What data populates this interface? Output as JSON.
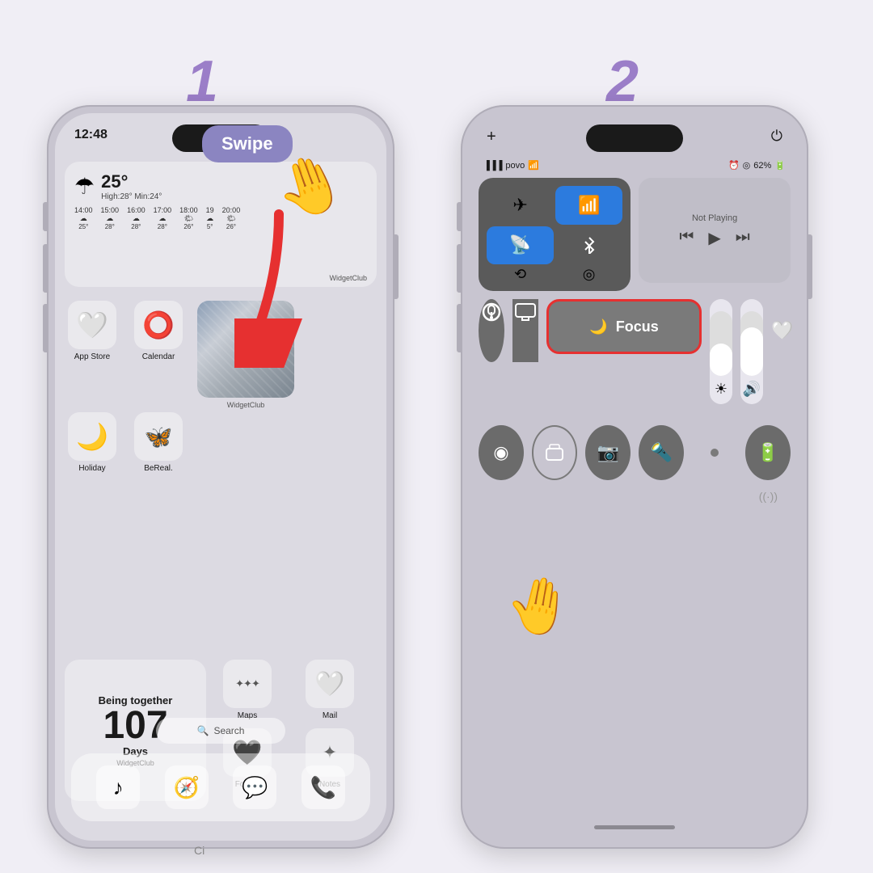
{
  "step1": {
    "number": "1",
    "swipe_label": "Swipe",
    "time": "12:48",
    "weather": {
      "temp": "25°",
      "high_low": "High:28° Min:24°",
      "hours": [
        "14:00",
        "15:00",
        "16:00",
        "17:00",
        "18:00",
        "19",
        "20:00"
      ],
      "temps": [
        "25°",
        "28°",
        "28°",
        "28°",
        "26°",
        "5°",
        "26°"
      ],
      "widget_name": "WidgetClub"
    },
    "apps_row1": [
      {
        "label": "App Store",
        "emoji": "🤍"
      },
      {
        "label": "Calendar",
        "emoji": "⭕"
      },
      {
        "label": "WidgetClub",
        "type": "image"
      }
    ],
    "apps_row2": [
      {
        "label": "Holiday",
        "emoji": "🌙"
      },
      {
        "label": "BeReal.",
        "emoji": "🦋"
      }
    ],
    "together": {
      "title": "Being together",
      "number": "107",
      "days": "Days",
      "widget_name": "WidgetClub"
    },
    "small_apps": [
      {
        "label": "Maps",
        "emoji": "✦✦✦"
      },
      {
        "label": "Mail",
        "emoji": "🤍"
      },
      {
        "label": "Foodie",
        "emoji": "🖤"
      },
      {
        "label": "Notes",
        "emoji": "✦"
      }
    ],
    "search_placeholder": "Search",
    "dock": [
      {
        "label": "Music",
        "emoji": "♪"
      },
      {
        "label": "Safari",
        "emoji": "🧭"
      },
      {
        "label": "Messages",
        "emoji": "💬"
      },
      {
        "label": "Phone",
        "emoji": "📞"
      }
    ]
  },
  "step2": {
    "number": "2",
    "status": {
      "signal": "povo",
      "wifi": true,
      "alarm": true,
      "battery": "62%"
    },
    "controls": {
      "airplane": "✈",
      "cellular": "📶",
      "bluetooth": "⚡",
      "airdrop": "📡",
      "wifi": "📶",
      "not_playing": "Not Playing",
      "focus_label": "Focus",
      "focus_icon": "🌙",
      "rotation_lock": "🔒",
      "screen_mirror": "⊞",
      "brightness_icon": "☀",
      "volume_icon": "🔊",
      "orientation_icon": "⟲",
      "camera_icon": "📷",
      "flashlight_icon": "🔦",
      "shazam_icon": "◉",
      "battery_icon": "🔋"
    }
  }
}
